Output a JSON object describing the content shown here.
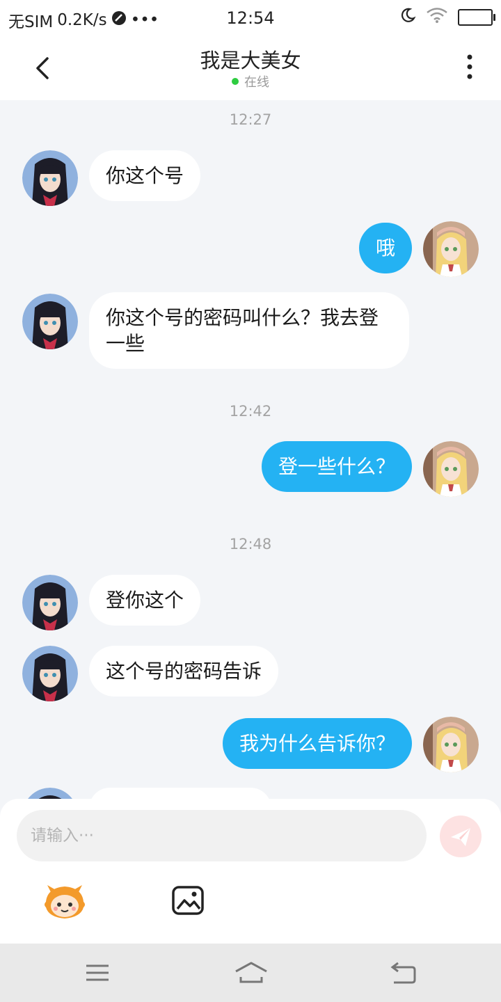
{
  "status_bar": {
    "carrier": "无SIM",
    "speed": "0.2K/s",
    "more": "•••",
    "time": "12:54"
  },
  "header": {
    "title": "我是大美女",
    "status": "在线"
  },
  "chat": {
    "timestamps": [
      "12:27",
      "12:42",
      "12:48"
    ],
    "messages": [
      {
        "side": "in",
        "text": "你这个号"
      },
      {
        "side": "out",
        "text": "哦"
      },
      {
        "side": "in",
        "text": "你这个号的密码叫什么？我去登一些"
      },
      {
        "side": "out",
        "text": "登一些什么？"
      },
      {
        "side": "in",
        "text": "登你这个"
      },
      {
        "side": "in",
        "text": "这个号的密码告诉"
      },
      {
        "side": "out",
        "text": "我为什么告诉你？"
      }
    ]
  },
  "composer": {
    "placeholder": "请输入···",
    "send_icon": "paper-plane-icon",
    "emoji_icon": "mascot-emoji-icon",
    "image_icon": "image-icon"
  },
  "navbar": {
    "icons": [
      "menu-icon",
      "home-icon",
      "back-icon"
    ]
  },
  "colors": {
    "accent": "#24b2f3",
    "background": "#f3f5f8",
    "online": "#2ecc40",
    "send_disabled": "#fde2e2"
  }
}
